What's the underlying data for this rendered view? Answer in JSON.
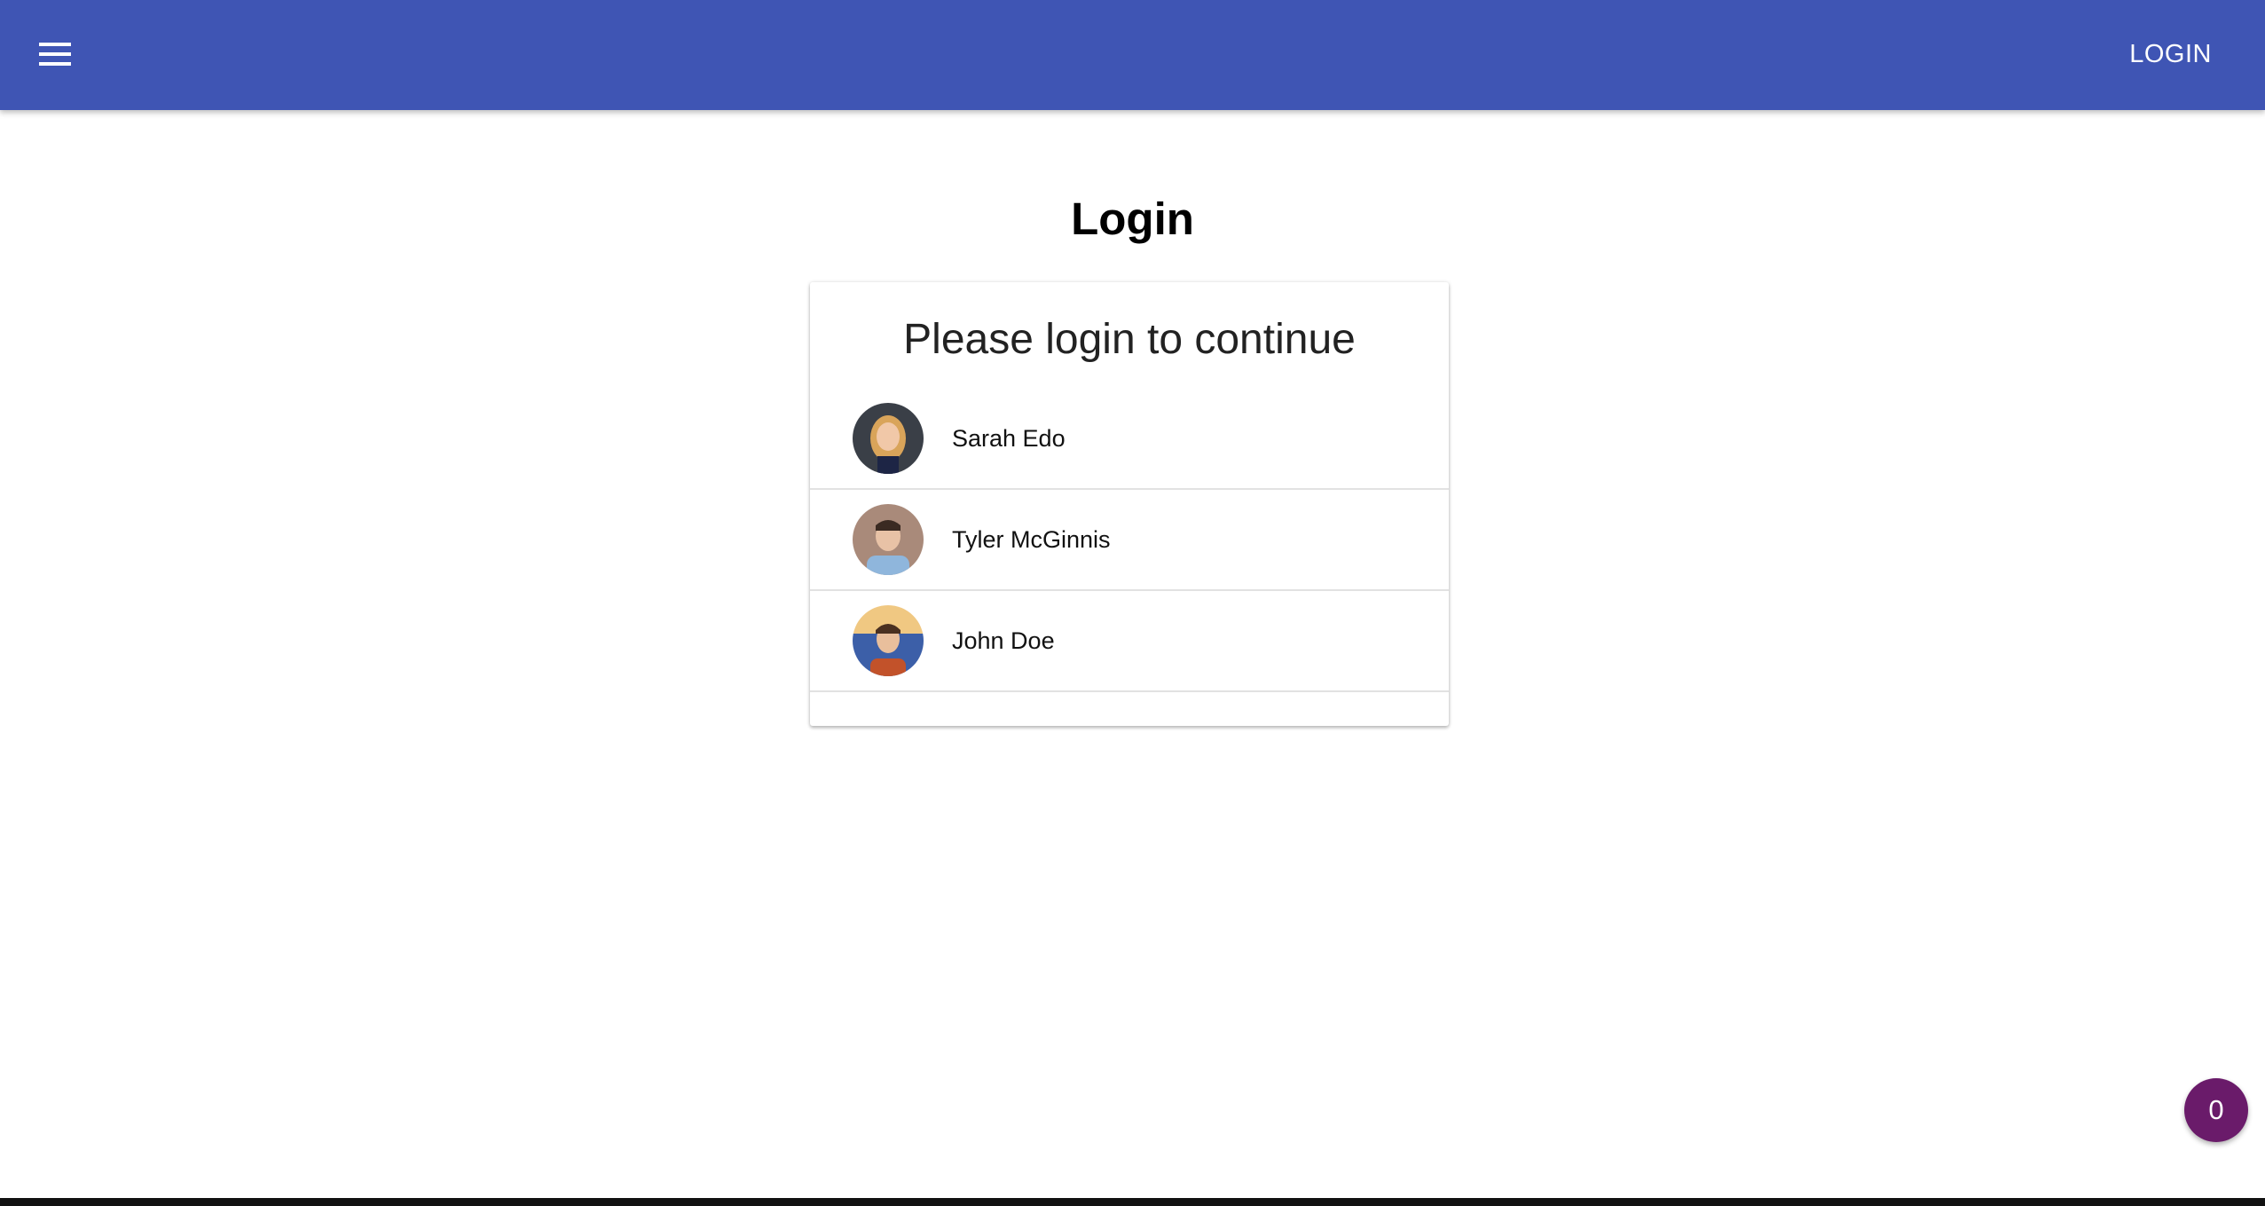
{
  "header": {
    "menu_icon": "hamburger-menu-icon",
    "login_label": "LOGIN",
    "color": "#3f55b4"
  },
  "page": {
    "title": "Login"
  },
  "card": {
    "title": "Please login to continue",
    "users": [
      {
        "name": "Sarah Edo",
        "avatar": "user-avatar-photo"
      },
      {
        "name": "Tyler McGinnis",
        "avatar": "user-avatar-photo"
      },
      {
        "name": "John Doe",
        "avatar": "user-avatar-photo"
      }
    ]
  },
  "fab": {
    "count": "0",
    "color": "#6a1b6a"
  }
}
